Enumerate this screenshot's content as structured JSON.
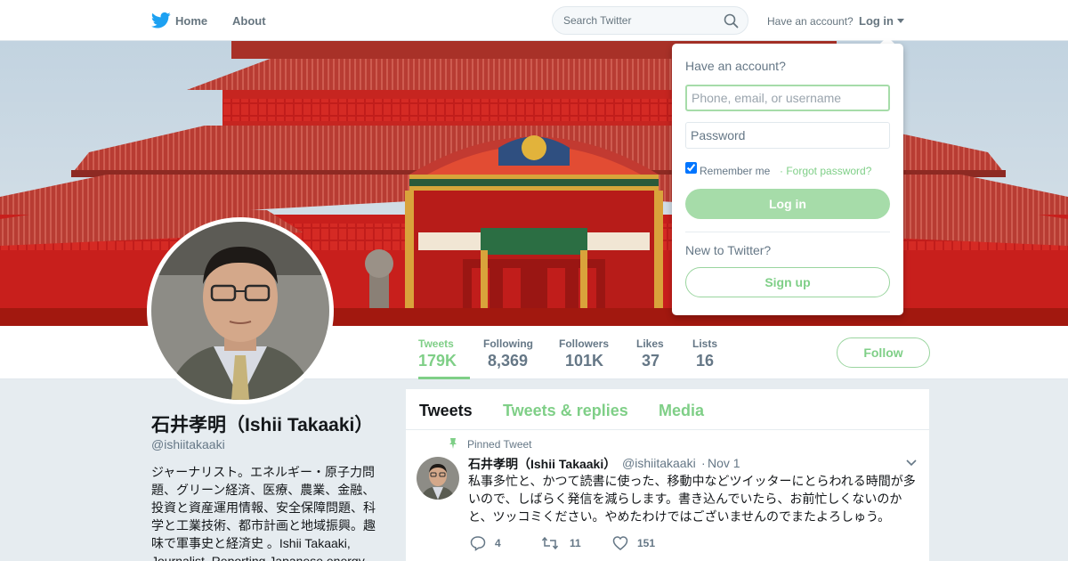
{
  "nav": {
    "home_label": "Home",
    "about_label": "About",
    "search_placeholder": "Search Twitter",
    "have_account": "Have an account?",
    "login_label": "Log in",
    "logo_icon": "twitter-bird-icon",
    "brand_color": "#1da1f2"
  },
  "profile": {
    "name": "石井孝明（Ishii Takaaki）",
    "handle": "@ishiitakaaki",
    "bio": "ジャーナリスト。エネルギー・原子力問題、グリーン経済、医療、農業、金融、投資と資産運用情報、安全保障問題、科学と工業技術、都市計画と地域振興。趣味で軍事史と経済史 。Ishii Takaaki, Journalist. Reporting Japanese energy"
  },
  "stats": [
    {
      "label": "Tweets",
      "value": "179K",
      "active": true
    },
    {
      "label": "Following",
      "value": "8,369"
    },
    {
      "label": "Followers",
      "value": "101K"
    },
    {
      "label": "Likes",
      "value": "37"
    },
    {
      "label": "Lists",
      "value": "16"
    }
  ],
  "follow_label": "Follow",
  "timeline": {
    "tabs": [
      "Tweets",
      "Tweets & replies",
      "Media"
    ],
    "pinned_label": "Pinned Tweet",
    "tweet": {
      "name": "石井孝明（Ishii Takaaki）",
      "handle": "@ishiitakaaki",
      "separator": "·",
      "date": "Nov 1",
      "text": "私事多忙と、かつて読書に使った、移動中などツイッターにとらわれる時間が多いので、しばらく発信を減らします。書き込んでいたら、お前忙しくないのかと、ツッコミください。やめたわけではございませんのでまたよろしゅう。",
      "replies": "4",
      "retweets": "11",
      "likes": "151"
    }
  },
  "login_dropdown": {
    "title": "Have an account?",
    "username_placeholder": "Phone, email, or username",
    "password_placeholder": "Password",
    "remember_label": "Remember me",
    "forgot_label": "· Forgot password?",
    "login_button": "Log in",
    "new_label": "New to Twitter?",
    "signup_button": "Sign up"
  },
  "colors": {
    "accent": "#7fcf87",
    "accent_light": "#a6dca9"
  }
}
